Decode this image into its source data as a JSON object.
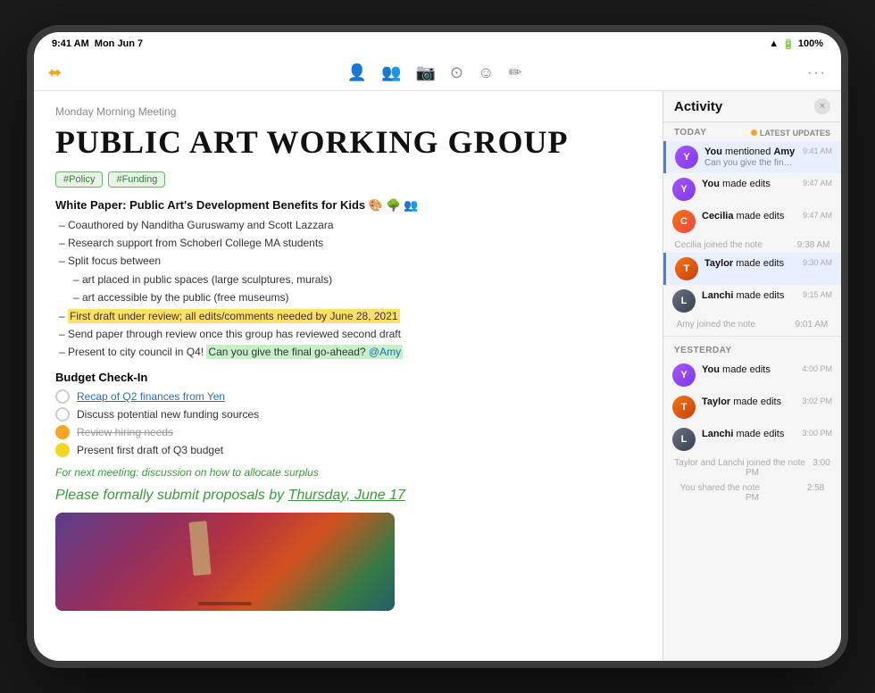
{
  "device": {
    "status_bar": {
      "time": "9:41 AM",
      "date": "Mon Jun 7",
      "wifi": "WiFi",
      "battery": "100%"
    }
  },
  "toolbar": {
    "menu_icon": "☰",
    "ellipsis": "···",
    "icons": [
      "👤",
      "👥",
      "📷",
      "⭕",
      "😊",
      "✏️"
    ]
  },
  "note": {
    "meeting_label": "Monday Morning Meeting",
    "title": "PUBLIC ART WORKING GROUP",
    "tags": [
      "#Policy",
      "#Funding"
    ],
    "white_paper_title": "White Paper: Public Art's Development Benefits for Kids 🎨 🌳 👥",
    "bullets": [
      "– Coauthored by Nanditha Guruswamy and Scott Lazzara",
      "– Research support from Schoberl College MA students",
      "– Split focus between",
      "– art placed in public spaces (large sculptures, murals)",
      "– art accessible by the public (free museums)",
      "– First draft under review; all edits/comments needed by June 28, 2021",
      "– Send paper through review once this group has reviewed second draft",
      "– Present to city council in Q4! Can you give the final go-ahead? @Amy"
    ],
    "budget_title": "Budget Check-In",
    "checklist": [
      {
        "label": "Recap of Q2 finances from Yen",
        "state": "unchecked",
        "strikethrough": false
      },
      {
        "label": "Discuss potential new funding sources",
        "state": "unchecked",
        "strikethrough": false
      },
      {
        "label": "Review hiring needs",
        "state": "checked-orange",
        "strikethrough": true
      },
      {
        "label": "Present first draft of Q3 budget",
        "state": "checked-yellow",
        "strikethrough": false
      }
    ],
    "next_meeting_note": "For next meeting: discussion on how to allocate surplus",
    "formal_submit": "Please formally submit proposals by Thursday, June 17"
  },
  "activity": {
    "title": "Activity",
    "close_label": "×",
    "today_label": "TODAY",
    "latest_updates_label": "LATEST UPDATES",
    "yesterday_label": "YESTERDAY",
    "items_today": [
      {
        "who": "You",
        "action": "mentioned Amy",
        "sub": "Can you give the final go-ahead? @Amy",
        "time": "9:41 AM",
        "avatar_type": "you",
        "highlighted": true
      },
      {
        "who": "You",
        "action": "made edits",
        "sub": "",
        "time": "9:47 AM",
        "avatar_type": "you",
        "highlighted": false
      },
      {
        "who": "Cecilia",
        "action": "made edits",
        "sub": "",
        "time": "9:47 AM",
        "avatar_type": "cecilia",
        "highlighted": false
      }
    ],
    "system_note_1": "Cecilia joined the note",
    "system_note_1_time": "9:38 AM",
    "items_today_2": [
      {
        "who": "Taylor",
        "action": "made edits",
        "sub": "",
        "time": "9:30 AM",
        "avatar_type": "taylor",
        "highlighted": true
      },
      {
        "who": "Lanchi",
        "action": "made edits",
        "sub": "",
        "time": "9:15 AM",
        "avatar_type": "lanchi",
        "highlighted": false
      }
    ],
    "system_note_2": "Amy joined the note",
    "system_note_2_time": "9:01 AM",
    "items_yesterday": [
      {
        "who": "You",
        "action": "made edits",
        "sub": "",
        "time": "4:00 PM",
        "avatar_type": "you",
        "highlighted": false
      },
      {
        "who": "Taylor",
        "action": "made edits",
        "sub": "",
        "time": "3:02 PM",
        "avatar_type": "taylor",
        "highlighted": false
      },
      {
        "who": "Lanchi",
        "action": "made edits",
        "sub": "",
        "time": "3:00 PM",
        "avatar_type": "lanchi",
        "highlighted": false
      }
    ],
    "system_note_3": "Taylor and Lanchi joined the note",
    "system_note_3_time": "3:00 PM",
    "system_note_4": "You shared the note",
    "system_note_4_time": "2:58 PM"
  }
}
